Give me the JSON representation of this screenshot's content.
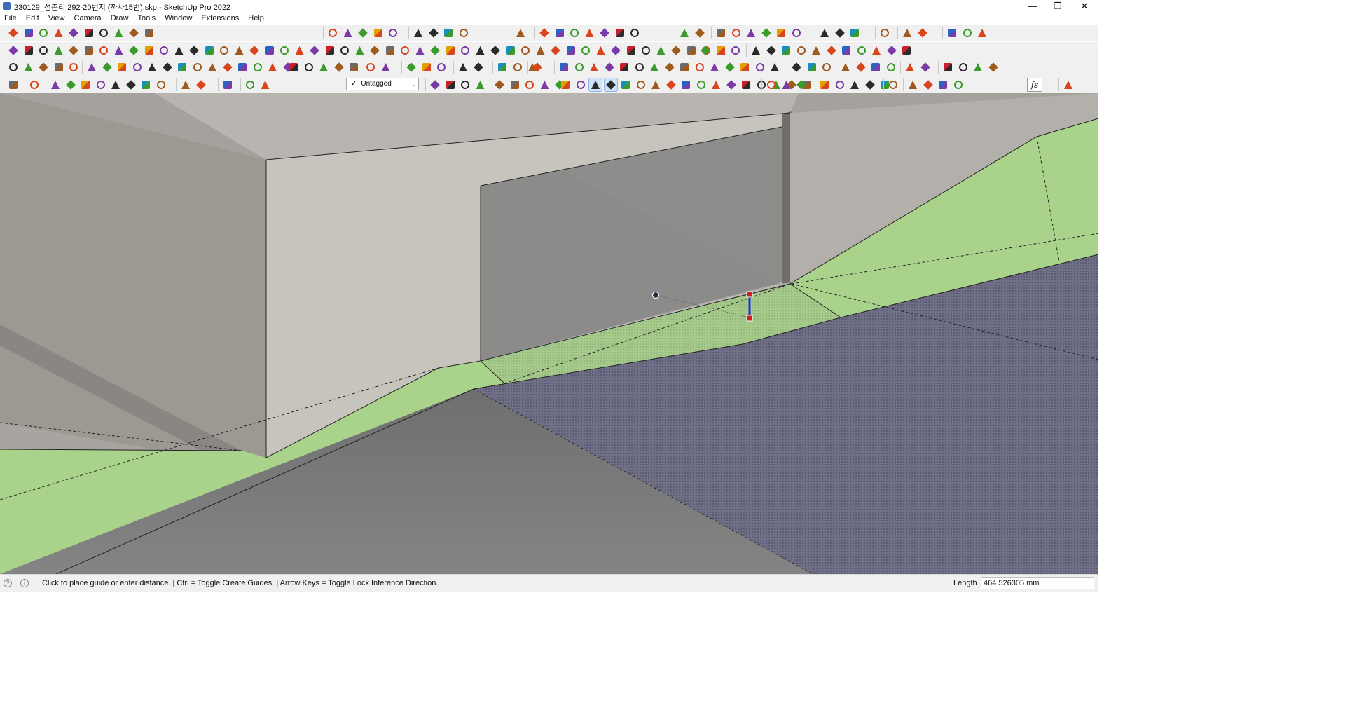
{
  "window": {
    "title": "230129_선촌리 292-20번지 (까사15번).skp - SketchUp Pro 2022",
    "minimize_glyph": "—",
    "restore_glyph": "❐",
    "close_glyph": "✕"
  },
  "menu": [
    "File",
    "Edit",
    "View",
    "Camera",
    "Draw",
    "Tools",
    "Window",
    "Extensions",
    "Help"
  ],
  "toolbar": {
    "tag_dropdown_value": "Untagged",
    "tag_check_glyph": "✓",
    "tag_dd_glyph": "⌄",
    "fs_label": "fs"
  },
  "statusbar": {
    "prompt": "Click to place guide or enter distance. | Ctrl = Toggle Create Guides. | Arrow Keys = Toggle Lock Inference Direction.",
    "length_label": "Length",
    "length_value": "464.526305 mm",
    "help_glyph": "?",
    "info_glyph": "i"
  },
  "colors": {
    "ground_green": "#a9d38a",
    "selected_face": "#9cc082",
    "wall": "#c6c3bd",
    "floor_gray": "#7b7b7b",
    "selection_blue": "#5a5a7a",
    "tape_line": "#1a2ed6",
    "endpoint": "#cc2222"
  }
}
